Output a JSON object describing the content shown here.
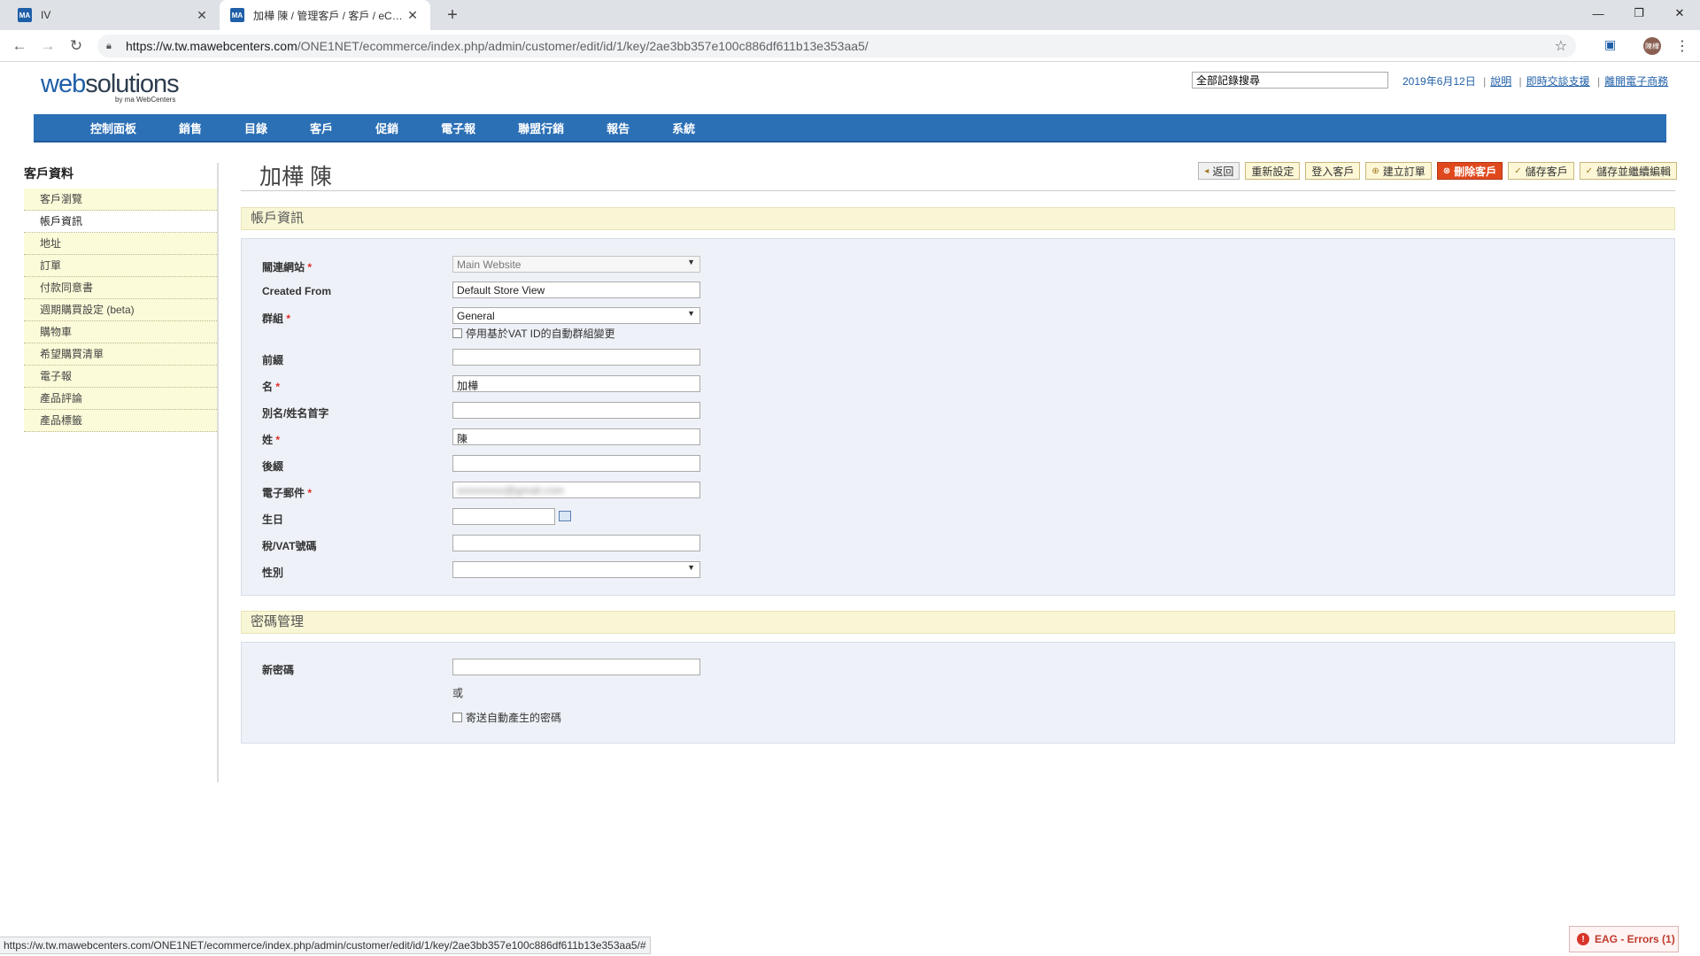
{
  "browser": {
    "tabs": [
      {
        "title": "IV",
        "favicon": "MA"
      },
      {
        "title": "加樺 陳 / 管理客戶 / 客戶 / eCom",
        "favicon": "MA"
      }
    ],
    "url_prefix": "https://w.tw.mawebcenters.com",
    "url_path": "/ONE1NET/ecommerce/index.php/admin/customer/edit/id/1/key/2ae3bb357e100c886df611b13e353aa5/",
    "profile": "陳樺",
    "status_url": "https://w.tw.mawebcenters.com/ONE1NET/ecommerce/index.php/admin/customer/edit/id/1/key/2ae3bb357e100c886df611b13e353aa5/#"
  },
  "header": {
    "logo_web": "web",
    "logo_rest": "solutions",
    "logo_sub": "by ma WebCenters",
    "search_value": "全部記錄搜尋",
    "date": "2019年6月12日",
    "links": [
      "說明",
      "即時交談支援",
      "離開電子商務"
    ]
  },
  "nav": [
    "控制面板",
    "銷售",
    "目錄",
    "客戶",
    "促銷",
    "電子報",
    "聯盟行銷",
    "報告",
    "系統"
  ],
  "sidebar": {
    "title": "客戶資料",
    "items": [
      "客戶瀏覽",
      "帳戶資訊",
      "地址",
      "訂單",
      "付款同意書",
      "週期購買設定 (beta)",
      "購物車",
      "希望購買清單",
      "電子報",
      "產品評論",
      "產品標籤"
    ]
  },
  "page": {
    "title": "加樺 陳",
    "buttons": {
      "back": "返回",
      "reset": "重新設定",
      "login": "登入客戶",
      "create_order": "建立訂單",
      "delete": "刪除客戶",
      "save": "儲存客戶",
      "save_continue": "儲存並繼續編輯"
    }
  },
  "account": {
    "section_title": "帳戶資訊",
    "website_label": "關連網站",
    "website_value": "Main Website",
    "created_from_label": "Created From",
    "created_from_value": "Default Store View",
    "group_label": "群組",
    "group_value": "General",
    "vat_checkbox_label": "停用基於VAT ID的自動群組變更",
    "prefix_label": "前綴",
    "prefix_value": "",
    "firstname_label": "名",
    "firstname_value": "加樺",
    "middlename_label": "別名/姓名首字",
    "middlename_value": "",
    "lastname_label": "姓",
    "lastname_value": "陳",
    "suffix_label": "後綴",
    "suffix_value": "",
    "email_label": "電子郵件",
    "email_value": "xxxxxxxxx@gmail.com",
    "dob_label": "生日",
    "dob_value": "",
    "taxvat_label": "稅/VAT號碼",
    "taxvat_value": "",
    "gender_label": "性別",
    "gender_value": ""
  },
  "password": {
    "section_title": "密碼管理",
    "new_password_label": "新密碼",
    "or_text": "或",
    "auto_password_label": "寄送自動產生的密碼"
  },
  "footer": {
    "errors_label": "EAG - Errors (1)"
  }
}
